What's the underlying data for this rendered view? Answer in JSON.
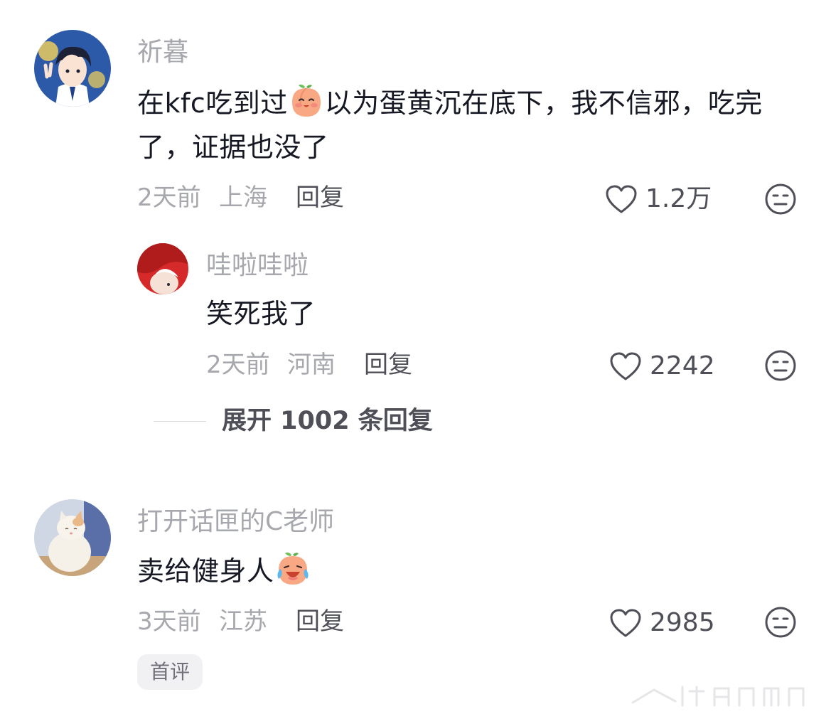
{
  "comments": [
    {
      "username": "祈暮",
      "text_before_emoji": "在kfc吃到过",
      "text_after_emoji": "以为蛋黄沉在底下，我不信邪，吃完了，证据也没了",
      "emoji_icon": "peach-smile-emoji-icon",
      "time": "2天前",
      "location": "上海",
      "reply_label": "回复",
      "like_count": "1.2万"
    },
    {
      "username": "哇啦哇啦",
      "text": "笑死我了",
      "time": "2天前",
      "location": "河南",
      "reply_label": "回复",
      "like_count": "2242"
    },
    {
      "username": "打开话匣的C老师",
      "text_before_emoji": "卖给健身人",
      "emoji_icon": "peach-laugh-cry-emoji-icon",
      "time": "3天前",
      "location": "江苏",
      "reply_label": "回复",
      "like_count": "2985",
      "tag": "首评"
    }
  ],
  "expand_replies": "展开 1002 条回复",
  "icons": {
    "like": "heart-outline-icon",
    "dislike": "meh-face-icon"
  },
  "colors": {
    "secondary_text": "#a7a8ad",
    "primary_text": "#161823",
    "action_text": "#4e4f57"
  }
}
